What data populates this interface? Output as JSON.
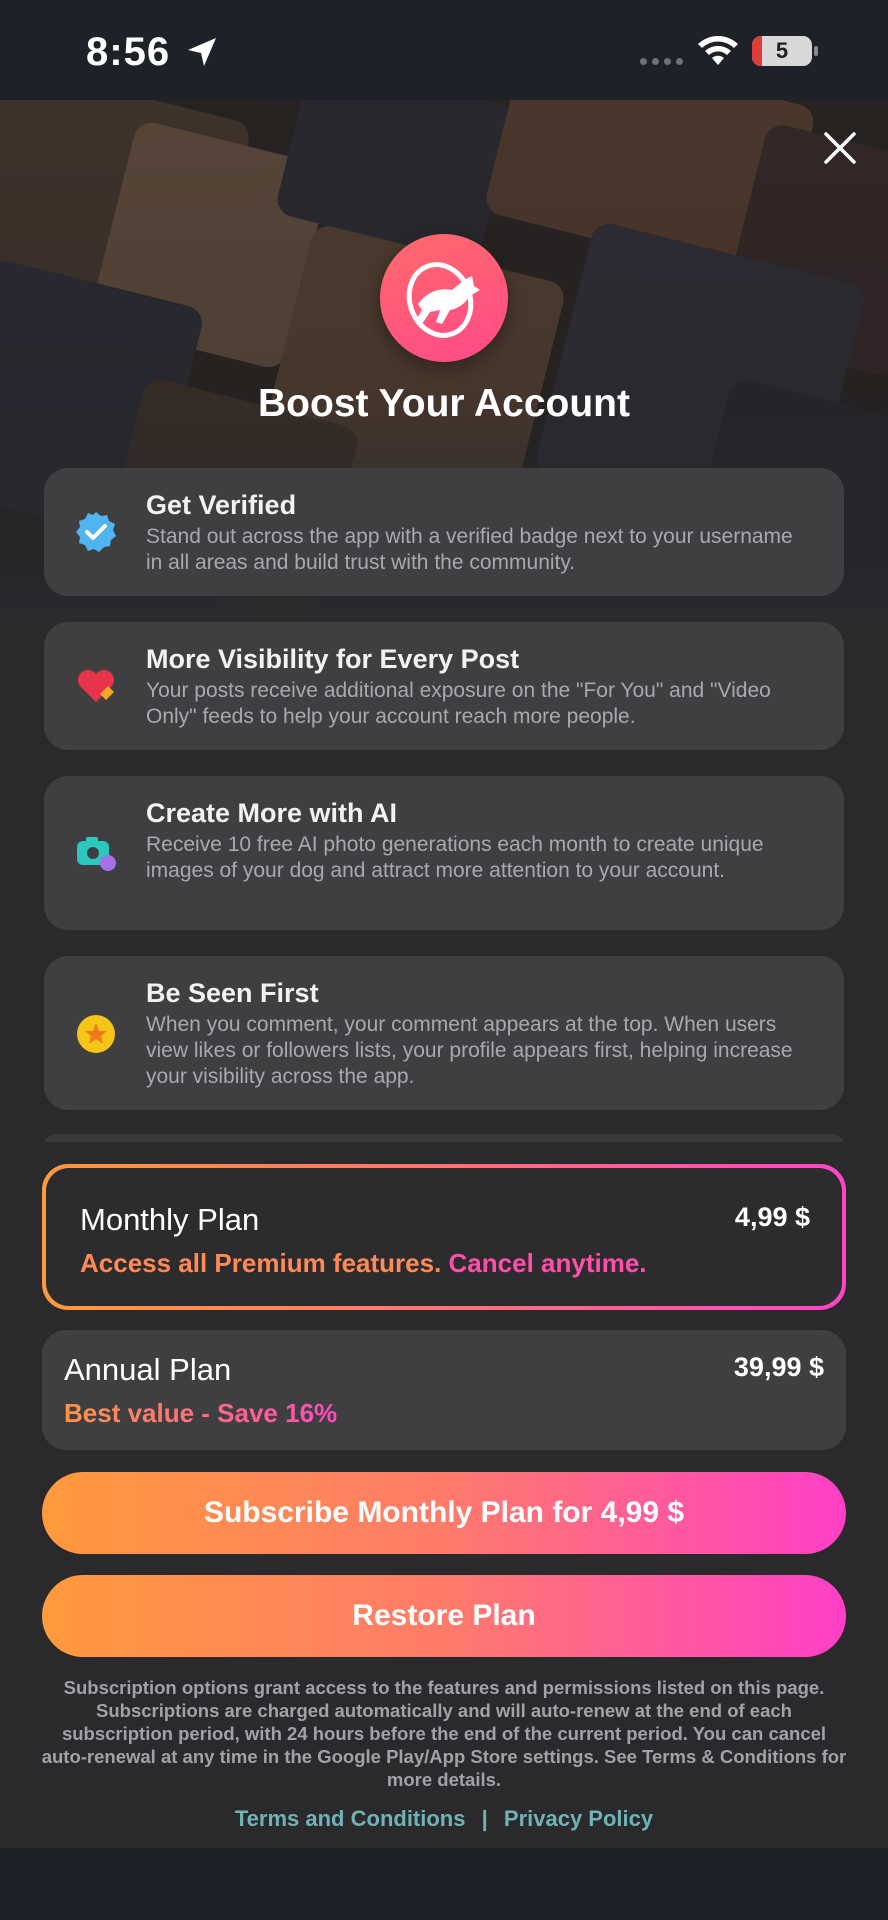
{
  "status_bar": {
    "time": "8:56",
    "battery": "5"
  },
  "hero": {
    "title": "Boost Your Account"
  },
  "features": [
    {
      "title": "Get Verified",
      "description": "Stand out across the app with a verified badge next to your username in all areas and build trust with the community.",
      "icon": "verified-badge-icon",
      "color": "#4fb4f0"
    },
    {
      "title": "More Visibility for Every Post",
      "description": "Your posts receive additional exposure on the \"For You\" and \"Video Only\" feeds to help your account reach more people.",
      "icon": "heart-icon",
      "color": "#e8344a"
    },
    {
      "title": "Create More with AI",
      "description": "Receive 10 free AI photo generations each month to create unique images of your dog and attract more attention to your account.",
      "icon": "camera-icon",
      "color": "#2bc8c0"
    },
    {
      "title": "Be Seen First",
      "description": "When you comment, your comment appears at the top. When users view likes or followers lists, your profile appears first, helping increase your visibility across the app.",
      "icon": "star-icon",
      "color": "#f5c518"
    }
  ],
  "plans": {
    "monthly": {
      "name": "Monthly Plan",
      "price": "4,99 $",
      "sub_a": "Access all Premium features.",
      "sub_b": "Cancel anytime."
    },
    "annual": {
      "name": "Annual Plan",
      "price": "39,99 $",
      "sub": "Best value - Save 16%"
    }
  },
  "buttons": {
    "subscribe": "Subscribe Monthly Plan for 4,99 $",
    "restore": "Restore Plan"
  },
  "legal": "Subscription options grant access to the features and permissions listed on this page. Subscriptions are charged automatically and will auto-renew at the end of each subscription period, with 24 hours before the end of the current period. You can cancel auto-renewal at any time in the Google Play/App Store settings. See Terms & Conditions for more details.",
  "links": {
    "terms": "Terms and Conditions",
    "separator": "|",
    "privacy": "Privacy Policy"
  },
  "colors": {
    "accent_start": "#ff9a3c",
    "accent_end": "#ff3fc7",
    "link": "#6fb3b6"
  }
}
